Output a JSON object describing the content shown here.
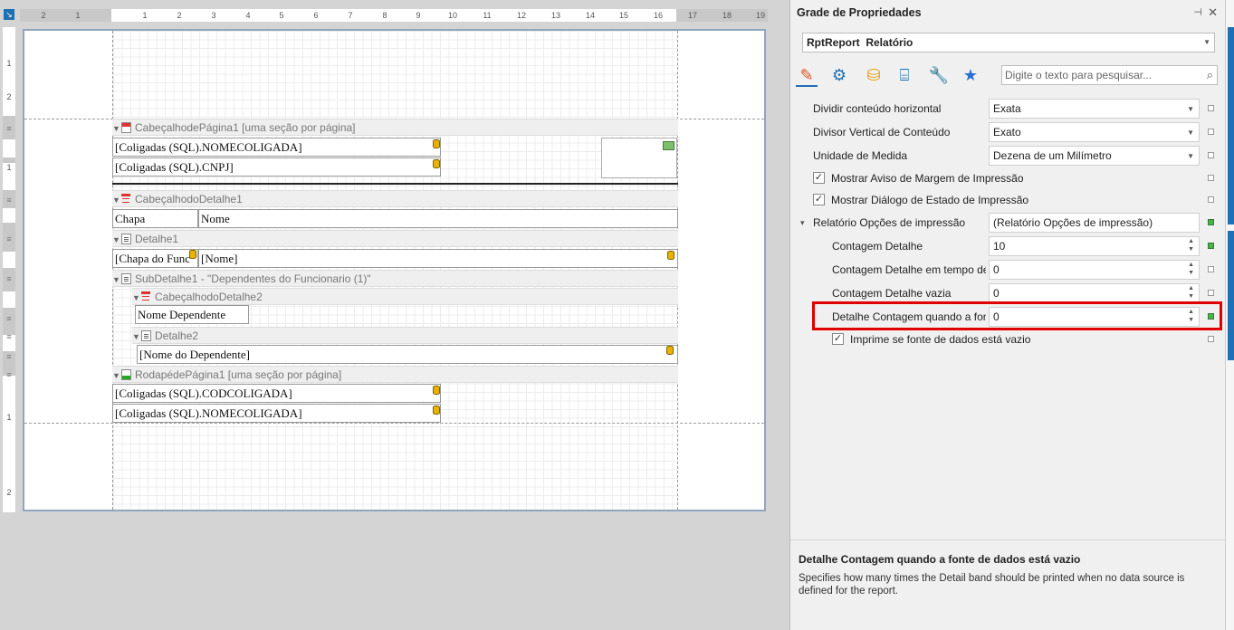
{
  "designer": {
    "ruler_h": [
      "2",
      "1",
      "1",
      "2",
      "3",
      "4",
      "5",
      "6",
      "7",
      "8",
      "9",
      "10",
      "11",
      "12",
      "13",
      "14",
      "15",
      "16",
      "17",
      "18",
      "19"
    ],
    "ruler_v": [
      "1",
      "2",
      "1",
      "1",
      "2"
    ],
    "bands": {
      "page_header": "CabeçalhodePágina1 [uma seção por página]",
      "detail_header1": "CabeçalhodoDetalhe1",
      "detail1": "Detalhe1",
      "subdetail1": "SubDetalhe1 - \"Dependentes do Funcionario (1)\"",
      "detail_header2": "CabeçalhodoDetalhe2",
      "detail2": "Detalhe2",
      "page_footer": "RodapédePágina1 [uma seção por página]"
    },
    "fields": {
      "nomecoligada_top": "[Coligadas (SQL).NOMECOLIGADA]",
      "cnpj": "[Coligadas (SQL).CNPJ]",
      "chapa_label": "Chapa",
      "nome_label": "Nome",
      "chapa_field": "[Chapa do Func",
      "nome_field": "[Nome]",
      "nome_dep_label": "Nome Dependente",
      "nome_dep_field": "[Nome do Dependente]",
      "codcoligada": "[Coligadas (SQL).CODCOLIGADA]",
      "nomecoligada_bottom": "[Coligadas (SQL).NOMECOLIGADA]"
    }
  },
  "property_grid": {
    "title": "Grade de Propriedades",
    "object_type": "RptReport",
    "object_name": "Relatório",
    "search_placeholder": "Digite o texto para pesquisar...",
    "properties": {
      "p1": {
        "label": "Dividir conteúdo horizontal",
        "value": "Exata"
      },
      "p2": {
        "label": "Divisor Vertical de Conteúdo",
        "value": "Exato"
      },
      "p3": {
        "label": "Unidade de Medida",
        "value": "Dezena de um Milímetro"
      },
      "p4": {
        "label": "Mostrar Aviso de Margem de Impressão",
        "checked": true
      },
      "p5": {
        "label": "Mostrar Diálogo de Estado de Impressão",
        "checked": true
      },
      "p6": {
        "label": "Relatório Opções de impressão",
        "value": "(Relatório Opções de impressão)"
      },
      "p7": {
        "label": "Contagem Detalhe",
        "value": "10"
      },
      "p8": {
        "label": "Contagem Detalhe em tempo de ...",
        "value": "0"
      },
      "p9": {
        "label": "Contagem Detalhe vazia",
        "value": "0"
      },
      "p10": {
        "label": "Detalhe Contagem quando a fon...",
        "value": "0"
      },
      "p11": {
        "label": "Imprime se fonte de dados está vazio",
        "checked": true
      }
    },
    "description": {
      "title": "Detalhe Contagem quando a fonte de dados está vazio",
      "text": "Specifies how many times the Detail band should be printed when no data source is defined for the report."
    }
  },
  "colors": {
    "highlight": "#e00000",
    "accent": "#1e6fb3",
    "changed_marker": "#4caf50"
  }
}
